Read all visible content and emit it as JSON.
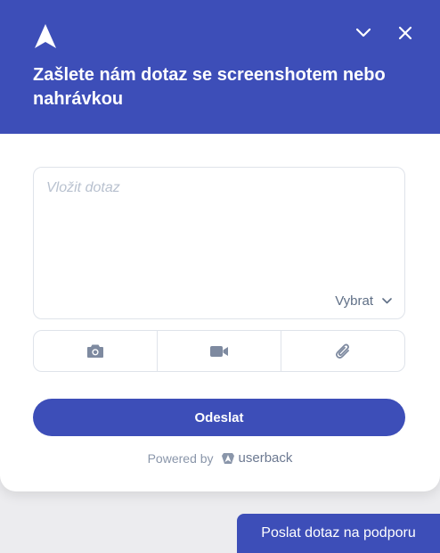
{
  "header": {
    "title": "Zašlete nám dotaz se screenshotem nebo nahrávkou",
    "logo_icon": "userback-arrow-logo",
    "minimize_icon": "chevron-down-icon",
    "close_icon": "close-icon"
  },
  "form": {
    "textarea_placeholder": "Vložit dotaz",
    "select_label": "Vybrat",
    "tools": [
      {
        "icon": "camera-icon"
      },
      {
        "icon": "video-icon"
      },
      {
        "icon": "paperclip-icon"
      }
    ],
    "submit_label": "Odeslat"
  },
  "footer": {
    "powered_by": "Powered by",
    "brand": "userback"
  },
  "launcher": {
    "label": "Poslat dotaz na podporu"
  },
  "colors": {
    "accent": "#3d4eb8",
    "placeholder": "#b8c1cf",
    "muted": "#8a96aa"
  }
}
